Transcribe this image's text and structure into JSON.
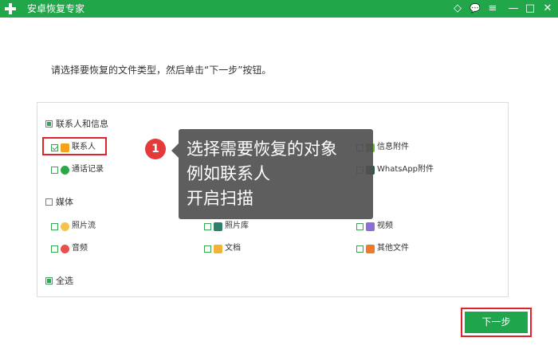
{
  "titlebar": {
    "title": "安卓恢复专家",
    "icons": [
      "diamond-icon",
      "chat-icon",
      "menu-icon",
      "minimize-icon",
      "maximize-icon",
      "close-icon"
    ],
    "icon_glyphs": {
      "diamond": "◇",
      "chat": "💬",
      "menu": "≡",
      "minimize": "—",
      "maximize": "□",
      "close": "✕"
    }
  },
  "instruction": "请选择要恢复的文件类型，然后单击“下一步”按钮。",
  "groups": {
    "contacts_messages": "联系人和信息",
    "media": "媒体",
    "select_all": "全选"
  },
  "items": {
    "contacts": "联系人",
    "call_log": "通话记录",
    "message_attachments": "信息附件",
    "whatsapp_attachments": "WhatsApp附件",
    "photo_stream": "照片流",
    "photo_library": "照片库",
    "video": "视频",
    "audio": "音频",
    "documents": "文档",
    "other_files": "其他文件"
  },
  "callout": {
    "step": "1",
    "line1": "选择需要恢复的对象",
    "line2": "例如联系人",
    "line3": "开启扫描"
  },
  "next_button": "下一步",
  "colors": {
    "brand": "#22a64a",
    "highlight": "#e0232b",
    "badge": "#e53a3a"
  }
}
